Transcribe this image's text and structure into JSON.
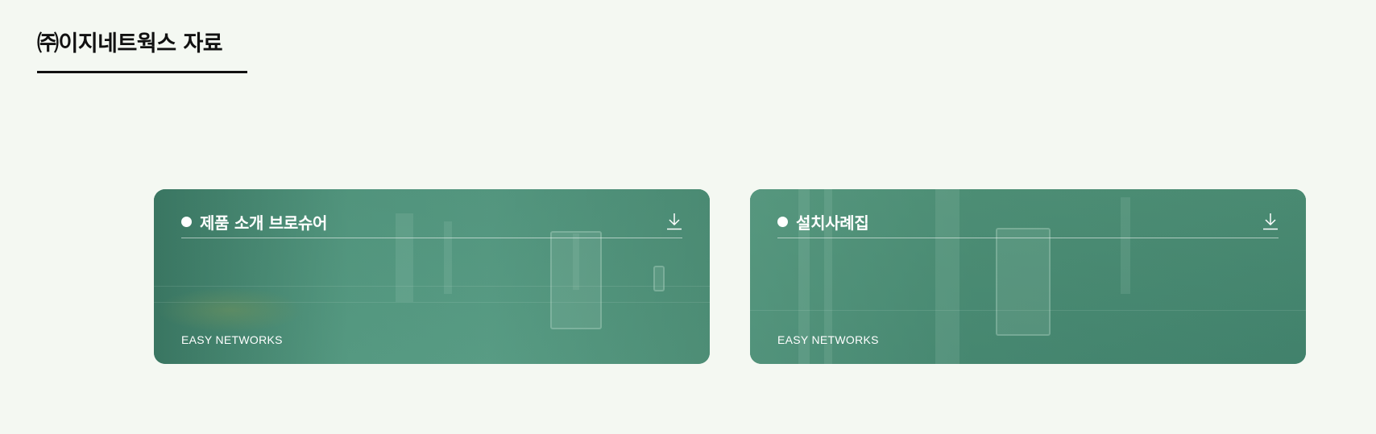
{
  "page": {
    "title": "㈜이지네트웍스 자료"
  },
  "cards": [
    {
      "title": "제품 소개 브로슈어",
      "footer": "EASY NETWORKS",
      "icon": "download-icon"
    },
    {
      "title": "설치사례집",
      "footer": "EASY NETWORKS",
      "icon": "download-icon"
    }
  ],
  "colors": {
    "background": "#f4f8f2",
    "card": "#4b8a75",
    "text_on_card": "#ffffff",
    "title": "#111111"
  }
}
